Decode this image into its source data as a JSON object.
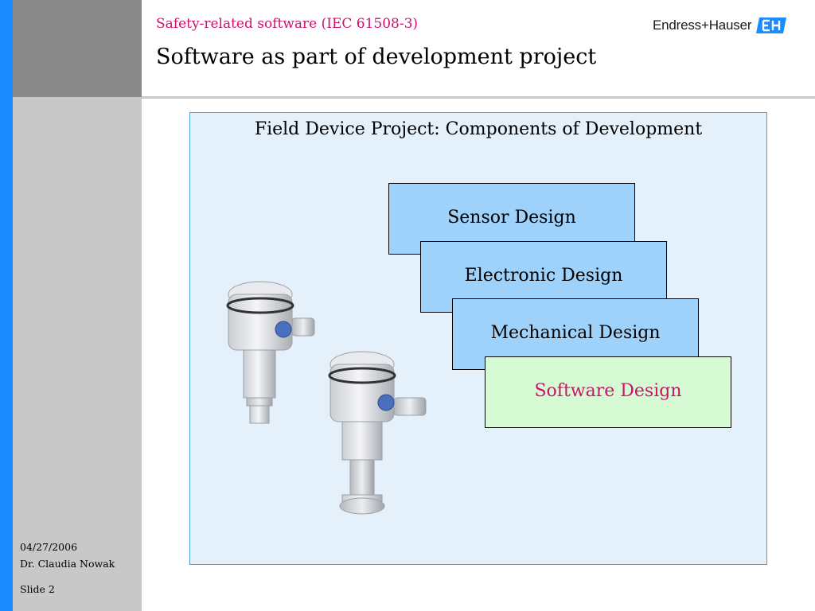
{
  "header": {
    "subtitle": "Safety-related software (IEC 61508-3)",
    "title": "Software as part of development project",
    "logo_text": "Endress+Hauser"
  },
  "footer": {
    "date": "04/27/2006",
    "author": "Dr. Claudia Nowak",
    "slide": "Slide 2"
  },
  "diagram": {
    "title": "Field Device Project: Components of Development",
    "boxes": [
      {
        "label": "Sensor Design"
      },
      {
        "label": "Electronic Design"
      },
      {
        "label": "Mechanical Design"
      },
      {
        "label": "Software Design"
      }
    ]
  },
  "colors": {
    "accent_blue": "#1a8cff",
    "highlight_magenta": "#d0106c",
    "panel_bg": "#e4f1fb",
    "box_blue": "#9fd2fb",
    "box_green": "#d6fbd4"
  },
  "icons": [
    "endress-hauser-logo-icon",
    "field-device-image"
  ]
}
